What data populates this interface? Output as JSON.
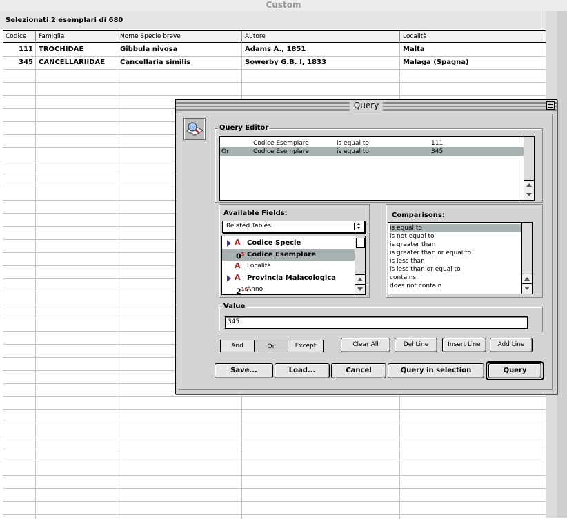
{
  "window": {
    "title": "Custom"
  },
  "selection": {
    "text": "Selezionati 2 esemplari di 680"
  },
  "table": {
    "columns": [
      "Codice",
      "Famiglia",
      "Nome Specie breve",
      "Autore",
      "Località"
    ],
    "rows": [
      [
        "111",
        "TROCHIDAE",
        "Gibbula nivosa",
        "Adams A., 1851",
        "Malta"
      ],
      [
        "345",
        "CANCELLARIIDAE",
        "Cancellaria similis",
        "Sowerby G.B. I, 1833",
        "Malaga (Spagna)"
      ]
    ]
  },
  "dialog": {
    "title": "Query",
    "query_editor": {
      "label": "Query Editor",
      "lines": [
        {
          "conj": "",
          "field": "Codice Esemplare",
          "op": "is equal to",
          "value": "111"
        },
        {
          "conj": "Or",
          "field": "Codice Esemplare",
          "op": "is equal to",
          "value": "345"
        }
      ]
    },
    "available_fields": {
      "label": "Available Fields:",
      "popup": "Related Tables",
      "items": [
        {
          "label": "Codice Specie",
          "bold": true
        },
        {
          "label": "Codice Esemplare",
          "bold": true
        },
        {
          "label": "Località",
          "bold": false
        },
        {
          "label": "Provincia Malacologica",
          "bold": true
        },
        {
          "label": "Anno",
          "bold": false
        }
      ]
    },
    "comparisons": {
      "label": "Comparisons:",
      "items": [
        "is equal to",
        "is not equal to",
        "is greater than",
        "is greater than or equal to",
        "is less than",
        "is less than or equal to",
        "contains",
        "does not contain"
      ]
    },
    "value": {
      "label": "Value",
      "text": "345"
    },
    "conjunctions": [
      "And",
      "Or",
      "Except"
    ],
    "line_buttons": [
      "Clear All",
      "Del Line",
      "Insert Line",
      "Add Line"
    ],
    "bottom_buttons": [
      "Save...",
      "Load...",
      "Cancel",
      "Query in selection",
      "Query"
    ],
    "colors": {
      "selection": "#a9b2b3",
      "dialog_bg": "#d4d4d4"
    }
  }
}
